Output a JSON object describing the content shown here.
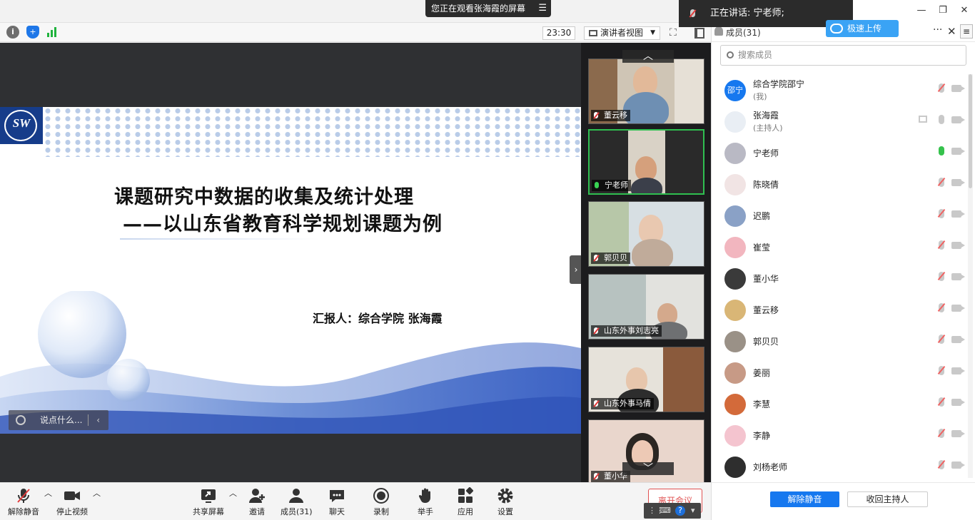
{
  "banner": {
    "viewing": "您正在观看张海霞的屏幕"
  },
  "toolstrip": {
    "timer": "23:30",
    "view_mode": "演讲者视图"
  },
  "slide": {
    "logo_text": "SW",
    "title": "课题研究中数据的收集及统计处理",
    "subtitle": "——以山东省教育科学规划课题为例",
    "presenter": "汇报人：综合学院  张海霞"
  },
  "chat": {
    "placeholder": "说点什么..."
  },
  "video_tiles": [
    {
      "name": "董云移",
      "mic": "muted"
    },
    {
      "name": "宁老师",
      "mic": "on"
    },
    {
      "name": "郭贝贝",
      "mic": "muted"
    },
    {
      "name": "山东外事刘志亮",
      "mic": "muted"
    },
    {
      "name": "山东外事马倩",
      "mic": "muted"
    },
    {
      "name": "董小华",
      "mic": "muted"
    }
  ],
  "toolbar": {
    "unmute": "解除静音",
    "stop_video": "停止视频",
    "share_screen": "共享屏幕",
    "invite": "邀请",
    "members": "成员(31)",
    "chat": "聊天",
    "record": "录制",
    "raise_hand": "举手",
    "apps": "应用",
    "settings": "设置",
    "end_meeting": "离开会议"
  },
  "right_panel": {
    "speaking": "正在讲话: 宁老师;",
    "baidu_badge": "极速上传",
    "title": "成员(31)",
    "search_placeholder": "搜索成员",
    "members": [
      {
        "name": "综合学院邵宁",
        "role": "(我)",
        "avatar_text": "邵宁",
        "avatar_color": "#1678ef",
        "mic": "muted"
      },
      {
        "name": "张海霞",
        "role": "(主持人)",
        "avatar_text": "",
        "avatar_color": "#e9eef4",
        "mic": "off",
        "sharing": true
      },
      {
        "name": "宁老师",
        "role": "",
        "avatar_text": "",
        "avatar_color": "#b9b9c4",
        "mic": "on"
      },
      {
        "name": "陈晓倩",
        "role": "",
        "avatar_text": "",
        "avatar_color": "#f1e4e4",
        "mic": "muted"
      },
      {
        "name": "迟鹏",
        "role": "",
        "avatar_text": "",
        "avatar_color": "#8aa1c6",
        "mic": "muted"
      },
      {
        "name": "崔莹",
        "role": "",
        "avatar_text": "",
        "avatar_color": "#f2b6bf",
        "mic": "muted"
      },
      {
        "name": "董小华",
        "role": "",
        "avatar_text": "",
        "avatar_color": "#3a3a3a",
        "mic": "muted"
      },
      {
        "name": "董云移",
        "role": "",
        "avatar_text": "",
        "avatar_color": "#d9b676",
        "mic": "muted"
      },
      {
        "name": "郭贝贝",
        "role": "",
        "avatar_text": "",
        "avatar_color": "#9a9187",
        "mic": "muted"
      },
      {
        "name": "姜丽",
        "role": "",
        "avatar_text": "",
        "avatar_color": "#c79a86",
        "mic": "muted"
      },
      {
        "name": "李慧",
        "role": "",
        "avatar_text": "",
        "avatar_color": "#d36a3a",
        "mic": "muted"
      },
      {
        "name": "李静",
        "role": "",
        "avatar_text": "",
        "avatar_color": "#f4c4cf",
        "mic": "muted"
      },
      {
        "name": "刘杨老师",
        "role": "",
        "avatar_text": "",
        "avatar_color": "#2e2e2e",
        "mic": "muted"
      }
    ],
    "unmute_all": "解除静音",
    "reclaim_host": "收回主持人"
  }
}
